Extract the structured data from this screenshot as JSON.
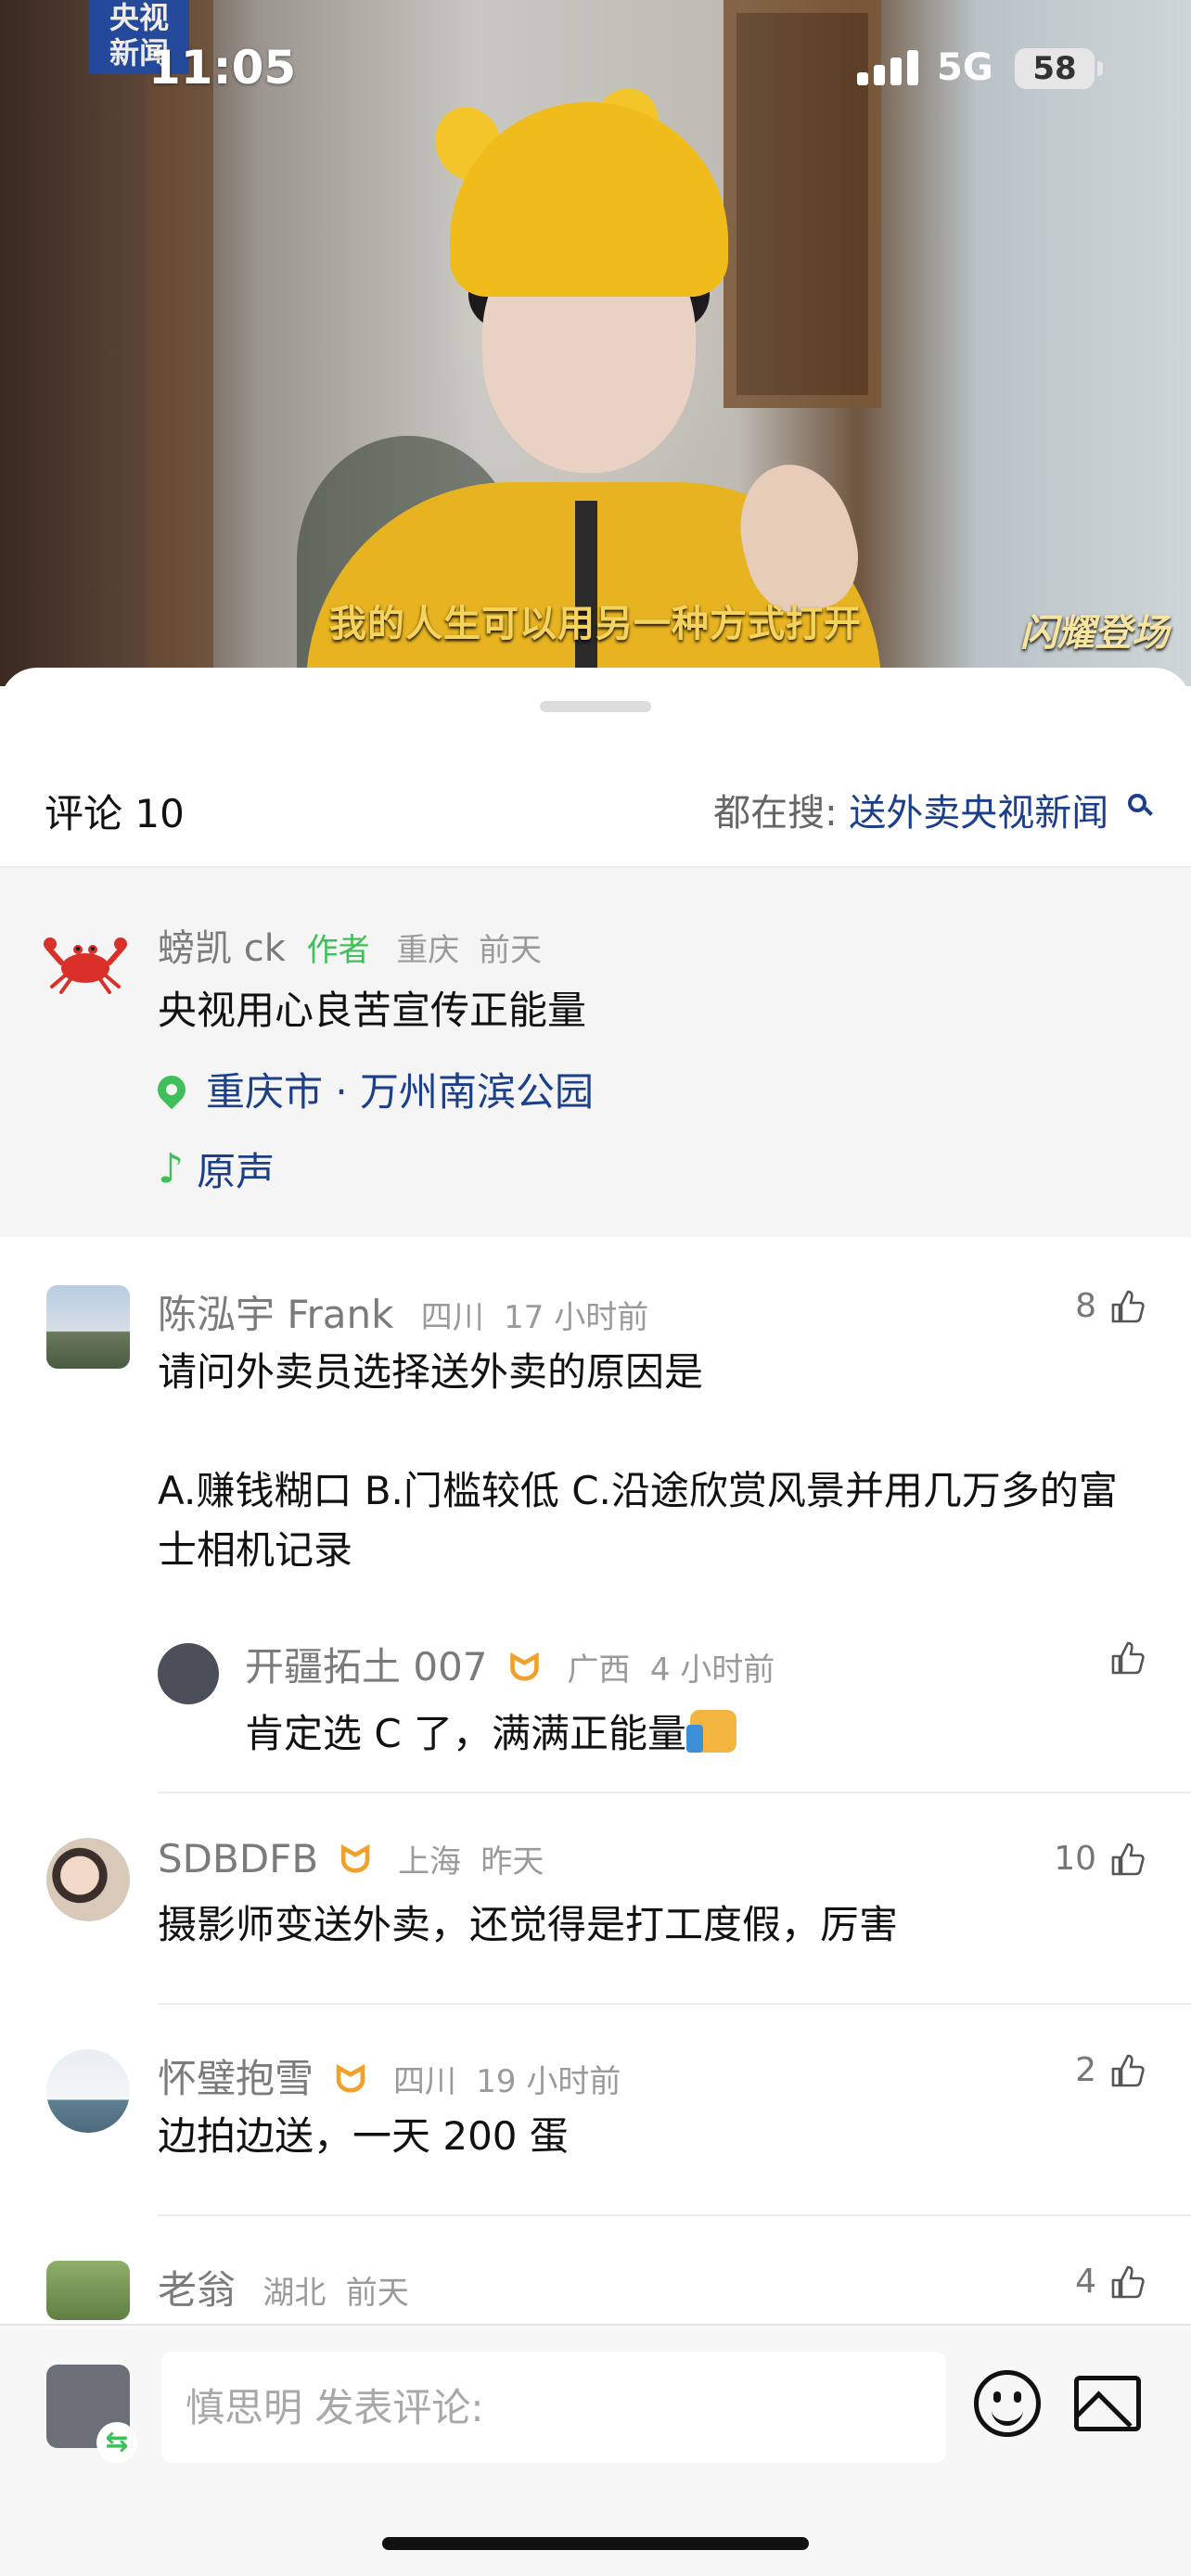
{
  "status_bar": {
    "time": "11:05",
    "network": "5G",
    "battery": "58"
  },
  "video": {
    "channel_logo": "央视\n新闻",
    "subtitle": "我的人生可以用另一种方式打开",
    "program_logo": "闪耀登场"
  },
  "comments_panel": {
    "title": "评论 10",
    "search_prefix": "都在搜:",
    "search_term": "送外卖央视新闻"
  },
  "author_post": {
    "name": "螃凯 ck",
    "tag": "作者",
    "region": "重庆",
    "time": "前天",
    "text": "央视用心良苦宣传正能量",
    "location": "重庆市 · 万州南滨公园",
    "music": "原声"
  },
  "comments": [
    {
      "name": "陈泓宇 Frank",
      "region": "四川",
      "time": "17 小时前",
      "likes": "8",
      "text_line1": "请问外卖员选择送外卖的原因是",
      "text_options": "A.赚钱糊口     B.门槛较低     C.沿途欣赏风景并用几万多的富士相机记录",
      "reply": {
        "name": "开疆拓土 007",
        "region": "广西",
        "time": "4 小时前",
        "text": "肯定选 C 了，满满正能量"
      }
    },
    {
      "name": "SDBDFB",
      "region": "上海",
      "time": "昨天",
      "likes": "10",
      "text": "摄影师变送外卖，还觉得是打工度假，厉害"
    },
    {
      "name": "怀璧抱雪",
      "region": "四川",
      "time": "19 小时前",
      "likes": "2",
      "text": "边拍边送，一天 200 蛋"
    },
    {
      "name": "老翁",
      "region": "湖北",
      "time": "前天",
      "likes": "4"
    }
  ],
  "input": {
    "placeholder": "慎思明 发表评论:"
  },
  "colors": {
    "link": "#1c3f8a",
    "author_tag": "#3fbf5a",
    "vip": "#f0a12b"
  }
}
